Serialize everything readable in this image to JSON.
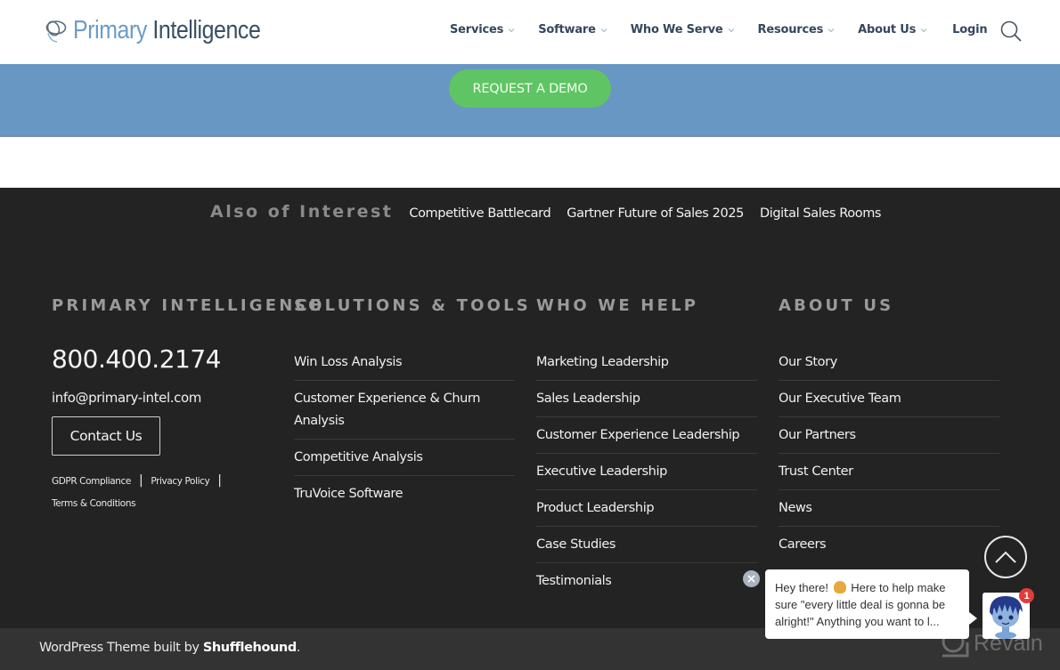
{
  "header": {
    "logo": {
      "part1": "Primary",
      "part2": "Intelligence"
    },
    "nav": [
      {
        "label": "Services",
        "has_dropdown": true
      },
      {
        "label": "Software",
        "has_dropdown": true
      },
      {
        "label": "Who We Serve",
        "has_dropdown": true
      },
      {
        "label": "Resources",
        "has_dropdown": true
      },
      {
        "label": "About Us",
        "has_dropdown": true
      }
    ],
    "login_label": "Login",
    "search_icon": "search-icon"
  },
  "cta": {
    "demo_label": "REQUEST A DEMO"
  },
  "also_of_interest": {
    "title": "Also of Interest",
    "links": [
      "Competitive Battlecard",
      "Gartner Future of Sales 2025",
      "Digital Sales Rooms"
    ]
  },
  "footer": {
    "company": {
      "heading": "PRIMARY INTELLIGENCE",
      "phone": "800.400.2174",
      "email": "info@primary-intel.com",
      "contact_label": "Contact Us",
      "legal": [
        "GDPR Compliance",
        "Privacy Policy",
        "Terms & Conditions"
      ],
      "separator": "|"
    },
    "solutions": {
      "heading": "SOLUTIONS & TOOLS",
      "items": [
        "Win Loss Analysis",
        "Customer Experience & Churn Analysis",
        "Competitive Analysis",
        "TruVoice Software"
      ]
    },
    "who_we_help": {
      "heading": "WHO WE HELP",
      "items": [
        "Marketing Leadership",
        "Sales Leadership",
        "Customer Experience Leadership",
        "Executive Leadership",
        "Product Leadership",
        "Case Studies",
        "Testimonials"
      ]
    },
    "about": {
      "heading": "ABOUT US",
      "items": [
        "Our Story",
        "Our Executive Team",
        "Our Partners",
        "Trust Center",
        "News",
        "Careers"
      ]
    }
  },
  "bottom_bar": {
    "credit_prefix": "WordPress Theme built by ",
    "credit_brand": "Shufflehound",
    "credit_suffix": "."
  },
  "chat": {
    "message_part1": "Hey there!",
    "message_part2": " Here to help make sure \"every little deal is gonna be alright!\" Anything you want to l...",
    "badge_count": "1",
    "watermark": "Revain"
  },
  "colors": {
    "brand_blue": "#6a9cc7",
    "brand_dark": "#3a4f63",
    "cta_band": "#6897c3",
    "demo_button": "#5fc463",
    "footer_bg": "#232323",
    "bottom_bar_bg": "#333333",
    "badge_red": "#e23b3b"
  }
}
